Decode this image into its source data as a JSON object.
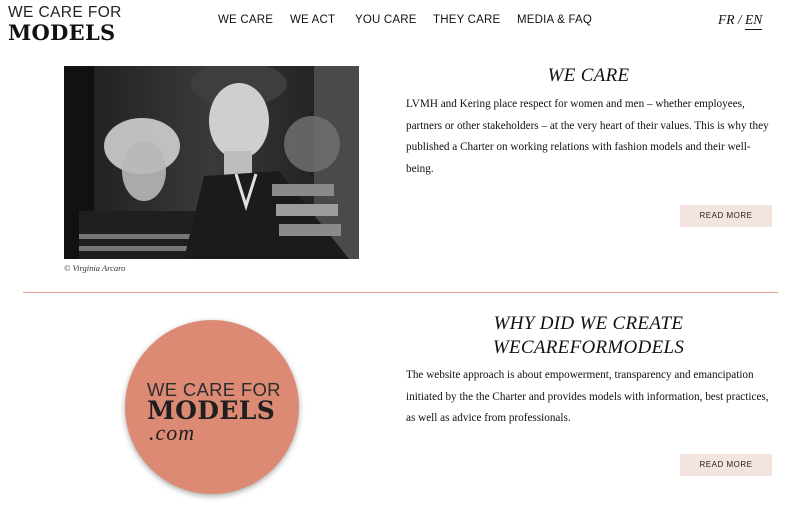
{
  "header": {
    "logo_line1": "WE CARE FOR",
    "logo_line2": "MODELS",
    "nav": [
      "WE CARE",
      "WE ACT",
      "YOU CARE",
      "THEY CARE",
      "MEDIA & FAQ"
    ],
    "lang_fr": "FR",
    "lang_sep": "/",
    "lang_en": "EN"
  },
  "section1": {
    "title": "WE CARE",
    "body": "LVMH and Kering place respect for women and men – whether employees, partners or other stakeholders – at the very heart of their values. This is why they published a Charter on working relations with fashion models and their well-being.",
    "button": "READ MORE",
    "photo_credit": "© Virginia Arcaro"
  },
  "section2": {
    "title_line1": "WHY DID WE CREATE",
    "title_line2": "WECAREFORMODELS",
    "body": "The website approach is about empowerment, transparency and emancipation initiated by the the Charter and provides models with information, best practices, as well as advice from professionals.",
    "button": "READ MORE",
    "logo_line1": "WE CARE FOR",
    "logo_line2": "MODELS",
    "logo_line3": ".com"
  },
  "colors": {
    "accent": "#dd8a74",
    "divider": "#e2a092",
    "button_bg": "#f3e4df"
  }
}
